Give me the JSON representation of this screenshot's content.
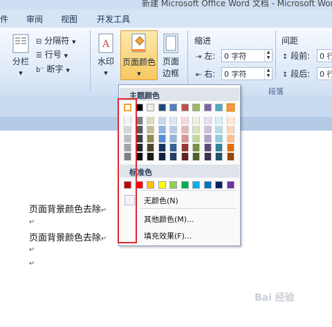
{
  "title_bar": {
    "text": "新建 Microsoft Office Word 文档 - Microsoft Word"
  },
  "tabs": [
    {
      "label": "件"
    },
    {
      "label": "审阅"
    },
    {
      "label": "视图"
    },
    {
      "label": "开发工具"
    }
  ],
  "ribbon": {
    "page_setup": {
      "columns_label": "分栏",
      "breaks_label": "分隔符",
      "line_numbers_label": "行号",
      "hyphenation_label": "断字"
    },
    "page_background": {
      "watermark_label": "水印",
      "page_color_label": "页面颜色",
      "page_borders_label_line1": "页面",
      "page_borders_label_line2": "边框"
    },
    "paragraph": {
      "indent_title": "缩进",
      "spacing_title": "间距",
      "indent_left_label": "左:",
      "indent_left_value": "0 字符",
      "indent_right_label": "右:",
      "indent_right_value": "0 字符",
      "spacing_before_label": "段前:",
      "spacing_before_value": "0 行",
      "spacing_after_label": "段后:",
      "spacing_after_value": "0 行",
      "group_label": "段落"
    }
  },
  "dropdown": {
    "theme_colors_header": "主题颜色",
    "standard_colors_header": "标准色",
    "no_color_label": "无颜色(N)",
    "more_colors_label": "其他颜色(M)...",
    "fill_effects_label": "填充效果(F)...",
    "theme_top_row": [
      "#ffffff",
      "#000000",
      "#eeece1",
      "#1f497d",
      "#4f81bd",
      "#c0504d",
      "#9bbb59",
      "#8064a2",
      "#4bacc6",
      "#f79646"
    ],
    "theme_shades": [
      [
        "#f2f2f2",
        "#7f7f7f",
        "#ddd9c3",
        "#c6d9f0",
        "#dbe5f1",
        "#f2dcdb",
        "#ebf1dd",
        "#e5e0ec",
        "#dbeef3",
        "#fdeada"
      ],
      [
        "#d8d8d8",
        "#595959",
        "#c4bd97",
        "#8db3e2",
        "#b8cce4",
        "#e5b9b7",
        "#d7e3bc",
        "#ccc1d9",
        "#b7dde8",
        "#fbd5b5"
      ],
      [
        "#bfbfbf",
        "#3f3f3f",
        "#938953",
        "#548dd4",
        "#95b3d7",
        "#d99694",
        "#c3d69b",
        "#b2a2c7",
        "#92cddc",
        "#fac08f"
      ],
      [
        "#a5a5a5",
        "#262626",
        "#494429",
        "#17365d",
        "#366092",
        "#953734",
        "#76923c",
        "#5f497a",
        "#31859b",
        "#e36c09"
      ],
      [
        "#7f7f7f",
        "#0c0c0c",
        "#1d1b10",
        "#0f243e",
        "#244061",
        "#632423",
        "#4f6128",
        "#3f3151",
        "#205867",
        "#974806"
      ]
    ],
    "standard_colors": [
      "#c00000",
      "#ff0000",
      "#ffc000",
      "#ffff00",
      "#92d050",
      "#00b050",
      "#00b0f0",
      "#0070c0",
      "#002060",
      "#7030a0"
    ]
  },
  "document": {
    "lines": [
      "页面背景颜色去除",
      "页面背景颜色去除"
    ],
    "paragraph_mark": "↵"
  },
  "watermark_text": "Bai 经验"
}
